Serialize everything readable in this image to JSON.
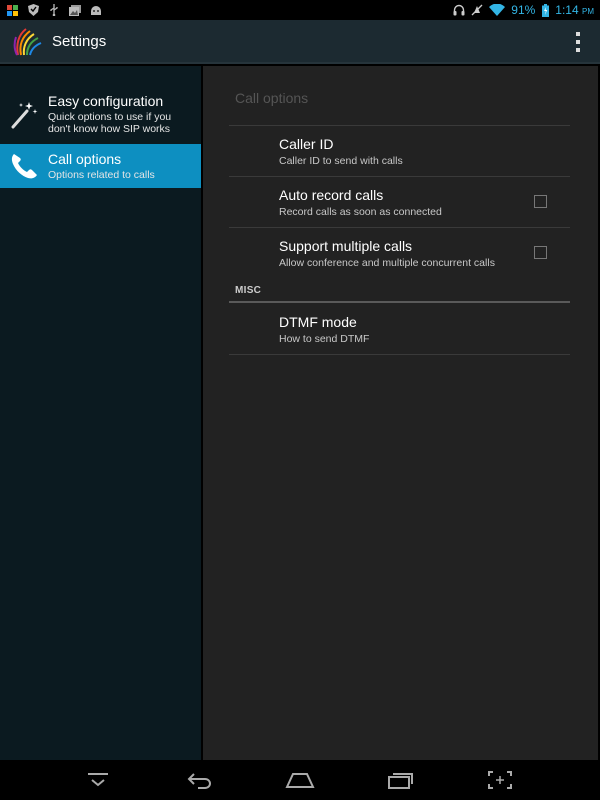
{
  "status_bar": {
    "battery_percent": "91%",
    "time": "1:14",
    "time_suffix": "PM",
    "accent_color": "#33b5e5"
  },
  "action_bar": {
    "title": "Settings"
  },
  "headers": [
    {
      "title": "Easy configuration",
      "summary_line1": "Quick options to use if you",
      "summary_line2": "don't know how SIP works",
      "icon": "magic-wand-icon",
      "selected": false
    },
    {
      "title": "Call options",
      "summary_line1": "Options related to calls",
      "icon": "phone-icon",
      "selected": true
    }
  ],
  "panel": {
    "title": "Call options",
    "preferences": [
      {
        "title": "Caller ID",
        "summary": "Caller ID to send with calls",
        "has_checkbox": false
      },
      {
        "title": "Auto record calls",
        "summary": "Record calls as soon as connected",
        "has_checkbox": true,
        "checked": false
      },
      {
        "title": "Support multiple calls",
        "summary": "Allow conference and multiple concurrent calls",
        "has_checkbox": true,
        "checked": false
      }
    ],
    "category": "MISC",
    "misc_preferences": [
      {
        "title": "DTMF mode",
        "summary": "How to send DTMF"
      }
    ]
  },
  "colors": {
    "selected_header": "#0d8fc1",
    "action_bar": "#1c2a31",
    "left_panel": "#0b1a20",
    "right_panel": "#222222"
  }
}
